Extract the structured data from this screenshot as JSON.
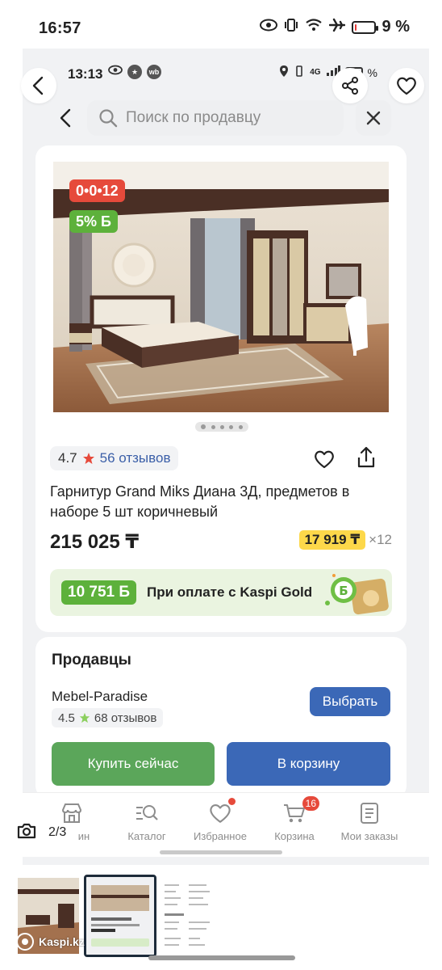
{
  "outer_status": {
    "time": "16:57",
    "battery": "9 %",
    "battery_level": 0.09
  },
  "inner_status": {
    "time": "13:13",
    "battery": "%",
    "battery_level": 0.2,
    "network": "4G"
  },
  "search": {
    "placeholder": "Поиск по продавцу"
  },
  "product": {
    "timer": "0•0•12",
    "bonus_badge": "5% Б",
    "rating": "4.7",
    "reviews": "56 отзывов",
    "title": "Гарнитур Grand Miks Диана 3Д, предметов в наборе 5 шт коричневый",
    "price": "215 025 ₸",
    "installment_amount": "17 919 ₸",
    "installment_months": "×12",
    "gold_bonus": "10 751 Б",
    "gold_text": "При оплате с Kaspi Gold"
  },
  "sellers": {
    "heading": "Продавцы",
    "seller_name": "Mebel-Paradise",
    "seller_rating": "4.5",
    "seller_reviews": "68 отзывов",
    "choose_label": "Выбрать",
    "buy_now_label": "Купить сейчас",
    "add_to_cart_label": "В корзину"
  },
  "bottom_nav": {
    "items": [
      {
        "label": "ин",
        "icon": "store-icon"
      },
      {
        "label": "Каталог",
        "icon": "catalog-search-icon"
      },
      {
        "label": "Избранное",
        "icon": "heart-icon"
      },
      {
        "label": "Корзина",
        "icon": "cart-icon",
        "badge": "16"
      },
      {
        "label": "Мои заказы",
        "icon": "orders-icon"
      }
    ]
  },
  "gallery": {
    "counter": "2/3",
    "watermark": "Kaspi.kz"
  },
  "colors": {
    "accent_blue": "#3b68b7",
    "accent_green": "#5ba65a",
    "bonus_green": "#5db13b",
    "timer_red": "#e64a3b",
    "installment_yellow": "#fdd84a"
  }
}
